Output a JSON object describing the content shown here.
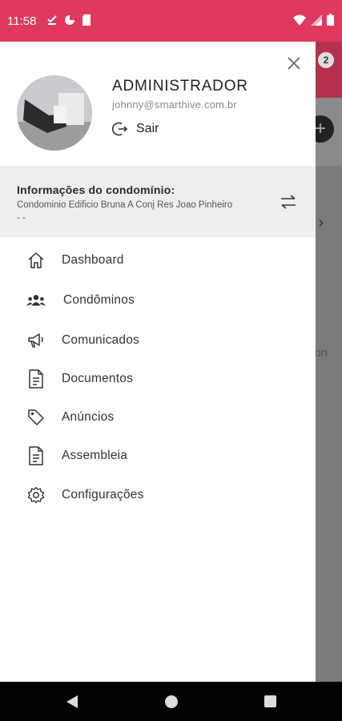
{
  "status_bar": {
    "time": "11:58",
    "bg_color": "#e0395f",
    "left_icons": [
      "download-done-icon",
      "data-saver-icon",
      "sd-card-icon"
    ],
    "right_icons": [
      "wifi-icon",
      "signal-icon",
      "battery-icon"
    ]
  },
  "background_app": {
    "notification_count": "2",
    "partial_text": "on"
  },
  "drawer": {
    "user": {
      "name": "ADMINISTRADOR",
      "email": "johnny@smarthive.com.br",
      "logout_label": "Sair"
    },
    "condo": {
      "title": "Informações do condomínio:",
      "description": "Condominio Edificio Bruna A Conj Res Joao Pinheiro -  -"
    },
    "menu": [
      {
        "label": "Dashboard",
        "icon": "home-icon"
      },
      {
        "label": "Condôminos",
        "icon": "people-icon"
      },
      {
        "label": "Comunicados",
        "icon": "megaphone-icon"
      },
      {
        "label": "Documentos",
        "icon": "document-icon"
      },
      {
        "label": "Anúncios",
        "icon": "tag-icon"
      },
      {
        "label": "Assembleia",
        "icon": "document-icon"
      },
      {
        "label": "Configurações",
        "icon": "gear-icon"
      }
    ]
  }
}
